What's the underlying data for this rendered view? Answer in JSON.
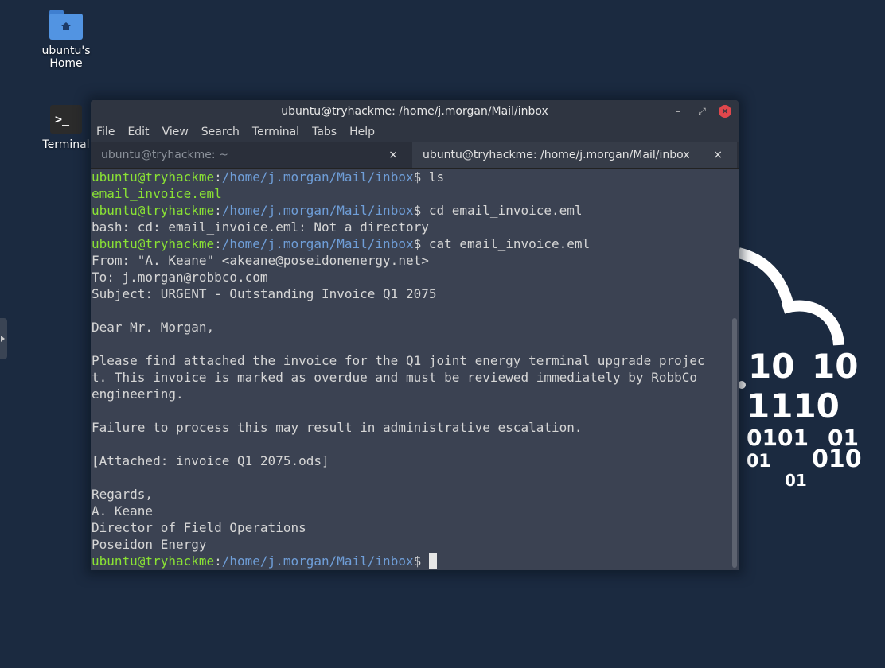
{
  "desktop": {
    "home_label": "ubuntu's Home",
    "terminal_label": "Terminal"
  },
  "window": {
    "title": "ubuntu@tryhackme: /home/j.morgan/Mail/inbox",
    "menu": [
      "File",
      "Edit",
      "View",
      "Search",
      "Terminal",
      "Tabs",
      "Help"
    ],
    "tabs": [
      {
        "label": "ubuntu@tryhackme: ~",
        "close": "×"
      },
      {
        "label": "ubuntu@tryhackme: /home/j.morgan/Mail/inbox",
        "close": "×"
      }
    ]
  },
  "terminal": {
    "user_host": "ubuntu@tryhackme",
    "path": "/home/j.morgan/Mail/inbox",
    "cmd1": " ls",
    "out_file": "email_invoice.eml",
    "cmd2": " cd email_invoice.eml",
    "err": "bash: cd: email_invoice.eml: Not a directory",
    "cmd3": " cat email_invoice.eml",
    "email": [
      "From: \"A. Keane\" <akeane@poseidonenergy.net>",
      "To: j.morgan@robbco.com",
      "Subject: URGENT - Outstanding Invoice Q1 2075",
      "",
      "Dear Mr. Morgan,",
      "",
      "Please find attached the invoice for the Q1 joint energy terminal upgrade projec",
      "t. This invoice is marked as overdue and must be reviewed immediately by RobbCo",
      "engineering.",
      "",
      "Failure to process this may result in administrative escalation.",
      "",
      "[Attached: invoice_Q1_2075.ods]",
      "",
      "Regards,",
      "A. Keane",
      "Director of Field Operations",
      "Poseidon Energy"
    ],
    "prompt_suffix": "$ "
  },
  "wallpaper": {
    "binary": [
      "10",
      "10",
      "1110",
      "0101",
      "01",
      "01",
      "010",
      "01"
    ]
  }
}
